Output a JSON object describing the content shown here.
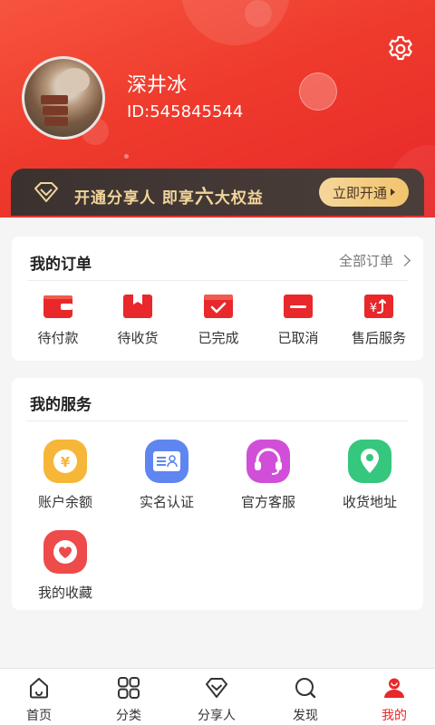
{
  "profile": {
    "name": "深井冰",
    "id_text": "ID:545845544"
  },
  "vip": {
    "text_prefix": "开通分享人 即享",
    "text_highlight": "六",
    "text_suffix": "大权益",
    "button_label": "立即开通"
  },
  "orders": {
    "title": "我的订单",
    "all_label": "全部订单",
    "items": [
      {
        "label": "待付款",
        "icon": "wallet-icon"
      },
      {
        "label": "待收货",
        "icon": "package-icon"
      },
      {
        "label": "已完成",
        "icon": "check-box-icon"
      },
      {
        "label": "已取消",
        "icon": "minus-box-icon"
      },
      {
        "label": "售后服务",
        "icon": "refund-icon"
      }
    ]
  },
  "services": {
    "title": "我的服务",
    "items": [
      {
        "label": "账户余额",
        "icon": "yen-coin-icon"
      },
      {
        "label": "实名认证",
        "icon": "id-card-icon"
      },
      {
        "label": "官方客服",
        "icon": "headset-icon"
      },
      {
        "label": "收货地址",
        "icon": "location-pin-icon"
      },
      {
        "label": "我的收藏",
        "icon": "heart-icon"
      }
    ]
  },
  "tabbar": {
    "items": [
      {
        "label": "首页",
        "icon": "home-icon",
        "active": false
      },
      {
        "label": "分类",
        "icon": "grid-icon",
        "active": false
      },
      {
        "label": "分享人",
        "icon": "diamond-icon",
        "active": false
      },
      {
        "label": "发现",
        "icon": "discover-icon",
        "active": false
      },
      {
        "label": "我的",
        "icon": "user-icon",
        "active": true
      }
    ]
  },
  "colors": {
    "brand_red": "#e8282a",
    "gold": "#f1d59a",
    "vip_dark": "#3b3230"
  }
}
